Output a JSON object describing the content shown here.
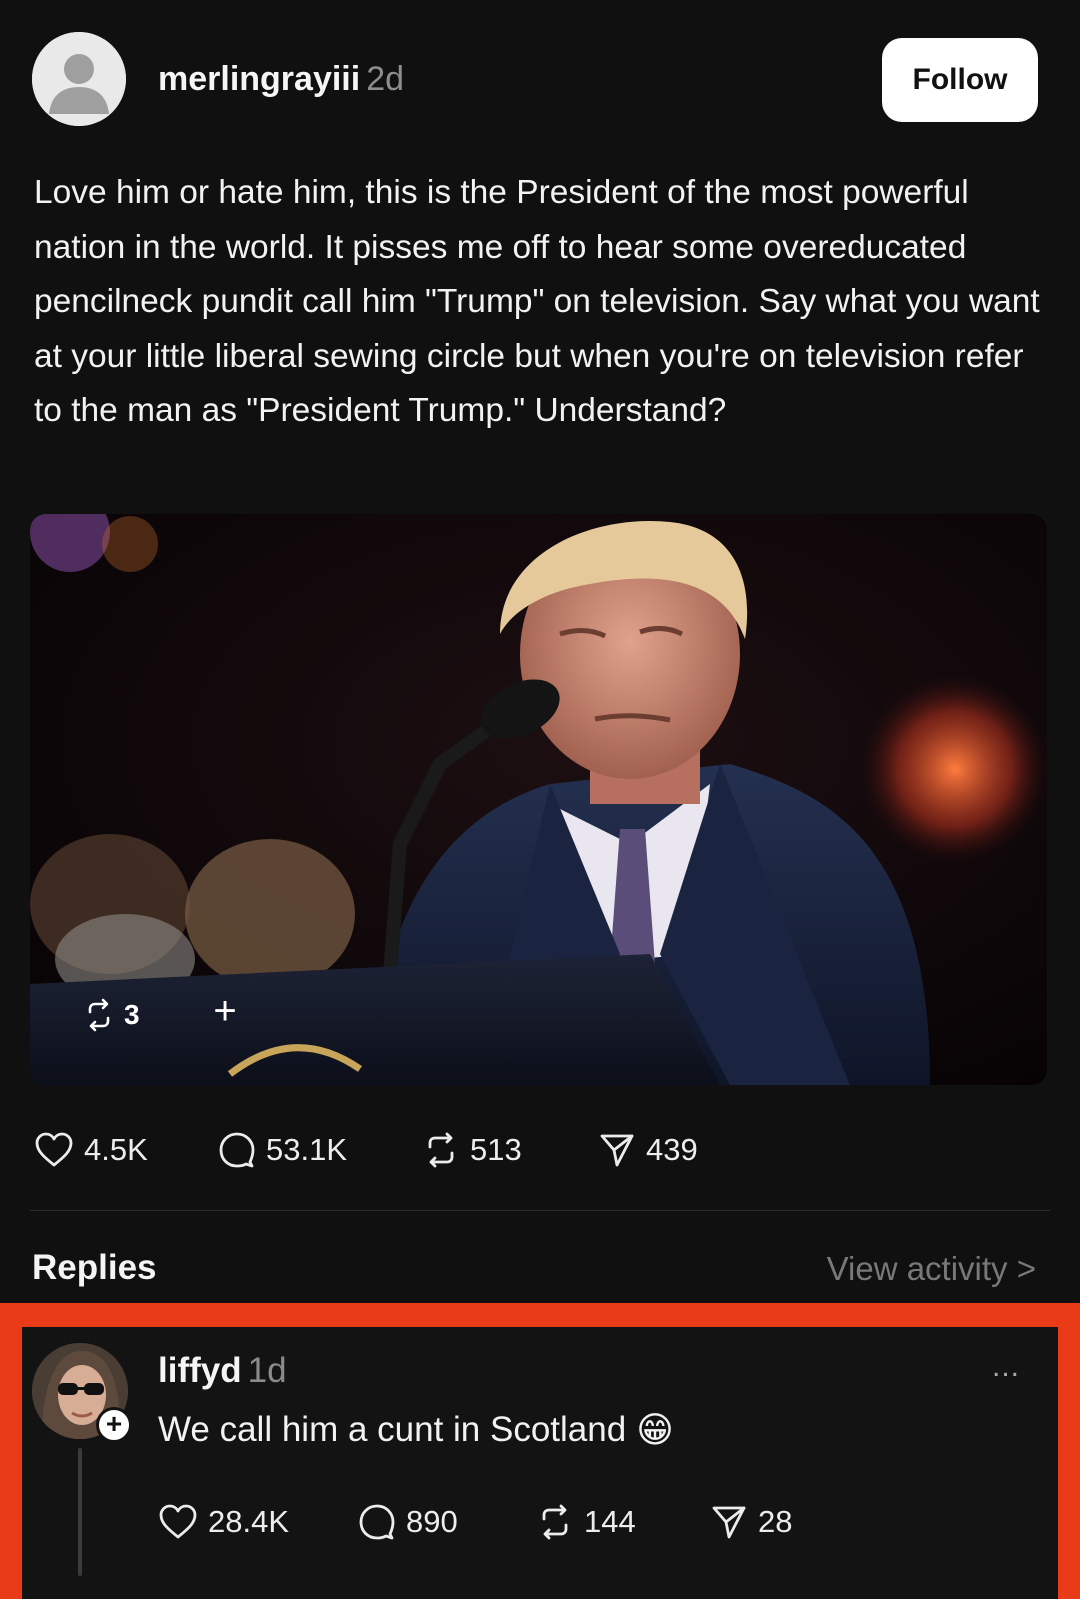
{
  "post": {
    "username": "merlingrayiii",
    "time": "2d",
    "follow_label": "Follow",
    "text": "Love him or hate him, this is the President of the most powerful nation in the world. It pisses me off to hear some overeducated pencilneck pundit call him \"Trump\" on television.  Say what you want at your little liberal sewing circle but when you're on television refer to the man as \"President Trump.\" Understand?",
    "media": {
      "repost_count": "3",
      "plus_label": "+"
    },
    "stats": {
      "likes": "4.5K",
      "replies": "53.1K",
      "reposts": "513",
      "shares": "439"
    }
  },
  "replies_section": {
    "title": "Replies",
    "view_activity": "View activity >"
  },
  "reply": {
    "username": "liffyd",
    "time": "1d",
    "more_label": "...",
    "plus_label": "+",
    "text": "We call him a cunt in Scotland",
    "emoji": "😁",
    "stats": {
      "likes": "28.4K",
      "replies": "890",
      "reposts": "144",
      "shares": "28"
    }
  },
  "colors": {
    "background": "#101010",
    "highlight_border": "#e93b17",
    "muted_text": "#8d8d8d"
  }
}
